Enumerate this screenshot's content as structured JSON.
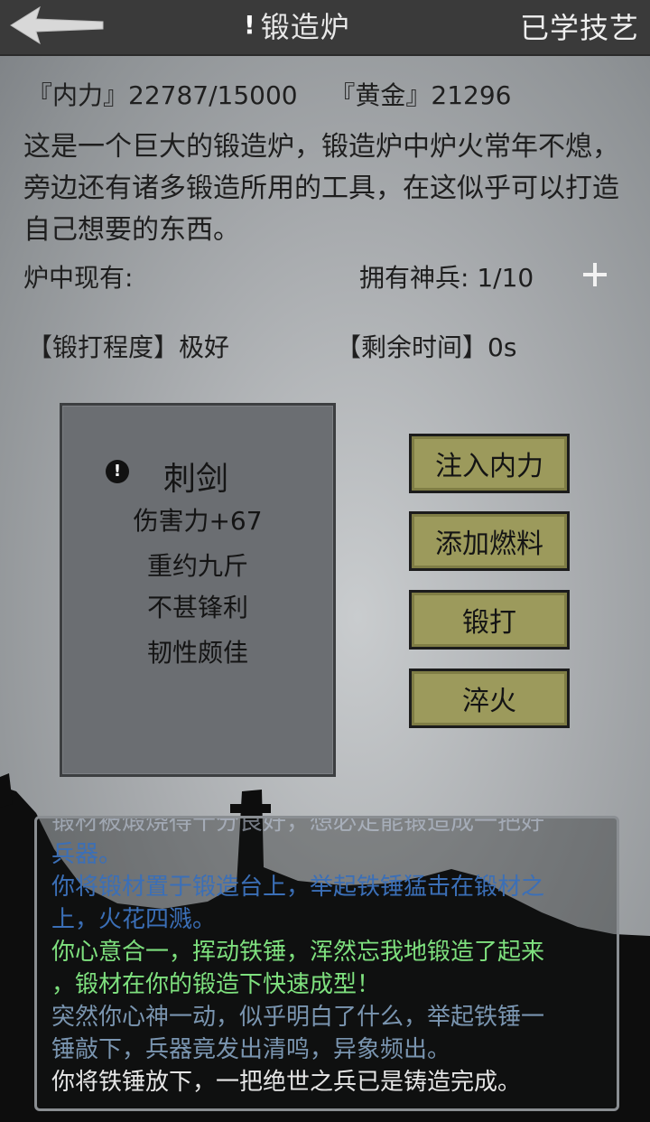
{
  "header": {
    "back_icon": "back-arrow-icon",
    "alert_mark": "!",
    "title": "锻造炉",
    "learned_skills": "已学技艺"
  },
  "stats": {
    "neili_label": "『内力』",
    "neili_value": "22787/15000",
    "gold_label": "『黄金』",
    "gold_value": "21296"
  },
  "description": "这是一个巨大的锻造炉，锻造炉中炉火常年不熄，旁边还有诸多锻造所用的工具，在这似乎可以打造自己想要的东西。",
  "furnace": {
    "contents_label": "炉中现有:",
    "weapons_label": "拥有神兵:",
    "weapons_count": "1/10",
    "forge_level_label": "【锻打程度】",
    "forge_level_value": "极好",
    "time_label": "【剩余时间】",
    "time_value": "0s"
  },
  "item": {
    "alert": "!",
    "name": "刺剑",
    "attributes": [
      "伤害力+67",
      "重约九斤",
      "不甚锋利",
      "韧性颇佳"
    ]
  },
  "actions": [
    "注入内力",
    "添加燃料",
    "锻打",
    "淬火"
  ],
  "log": [
    {
      "text": "锻材被煅烧得十分良好，想必定能锻造成一把好",
      "style": "faint"
    },
    {
      "text": "兵器。",
      "style": "blue"
    },
    {
      "text": "你将锻材置于锻造台上，举起铁锤猛击在锻材之",
      "style": "blue"
    },
    {
      "text": "上，火花四溅。",
      "style": "blue"
    },
    {
      "text": "你心意合一，挥动铁锤，浑然忘我地锻造了起来",
      "style": "green"
    },
    {
      "text": "，锻材在你的锻造下快速成型！",
      "style": "green"
    },
    {
      "text": "突然你心神一动，似乎明白了什么，举起铁锤一",
      "style": "gray"
    },
    {
      "text": "锤敲下，兵器竟发出清鸣，异象频出。",
      "style": "gray"
    },
    {
      "text": "你将铁锤放下，一把绝世之兵已是铸造完成。",
      "style": "white"
    }
  ],
  "colors": {
    "header_bg": "#3a3a3a",
    "button_bg": "#9c9a5c",
    "log_green": "#7ee07e",
    "log_blue": "#3b6fb7"
  }
}
